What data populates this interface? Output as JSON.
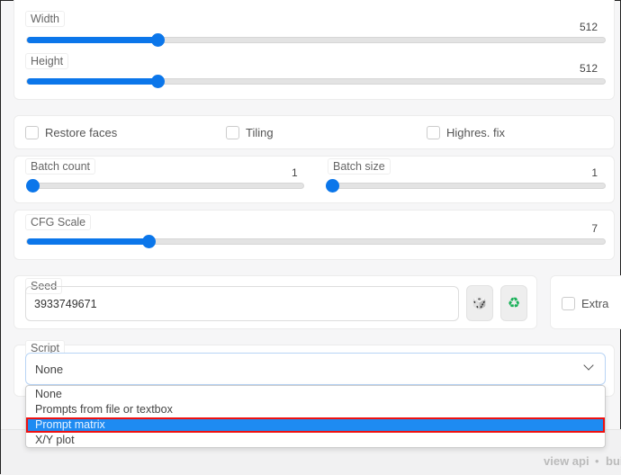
{
  "sliders": {
    "width": {
      "label": "Width",
      "value": "512",
      "fraction": 0.226
    },
    "height": {
      "label": "Height",
      "value": "512",
      "fraction": 0.226
    },
    "batch_count": {
      "label": "Batch count",
      "value": "1",
      "fraction": 0
    },
    "batch_size": {
      "label": "Batch size",
      "value": "1",
      "fraction": 0
    },
    "cfg_scale": {
      "label": "CFG Scale",
      "value": "7",
      "fraction": 0.21
    }
  },
  "checkboxes": {
    "restore_faces": "Restore faces",
    "tiling": "Tiling",
    "highres_fix": "Highres. fix",
    "extra": "Extra"
  },
  "seed": {
    "label": "Seed",
    "value": "3933749671",
    "dice_icon": "🎲",
    "recycle_icon": "♻"
  },
  "script": {
    "label": "Script",
    "selected": "None",
    "options": [
      "None",
      "Prompts from file or textbox",
      "Prompt matrix",
      "X/Y plot"
    ],
    "highlighted": "Prompt matrix"
  },
  "footer": {
    "view_api": "view api",
    "sep": "•",
    "built": "bui"
  },
  "colors": {
    "accent": "#0b76ea",
    "highlight": "#1e8bf2",
    "highlight_border": "#e11111"
  }
}
